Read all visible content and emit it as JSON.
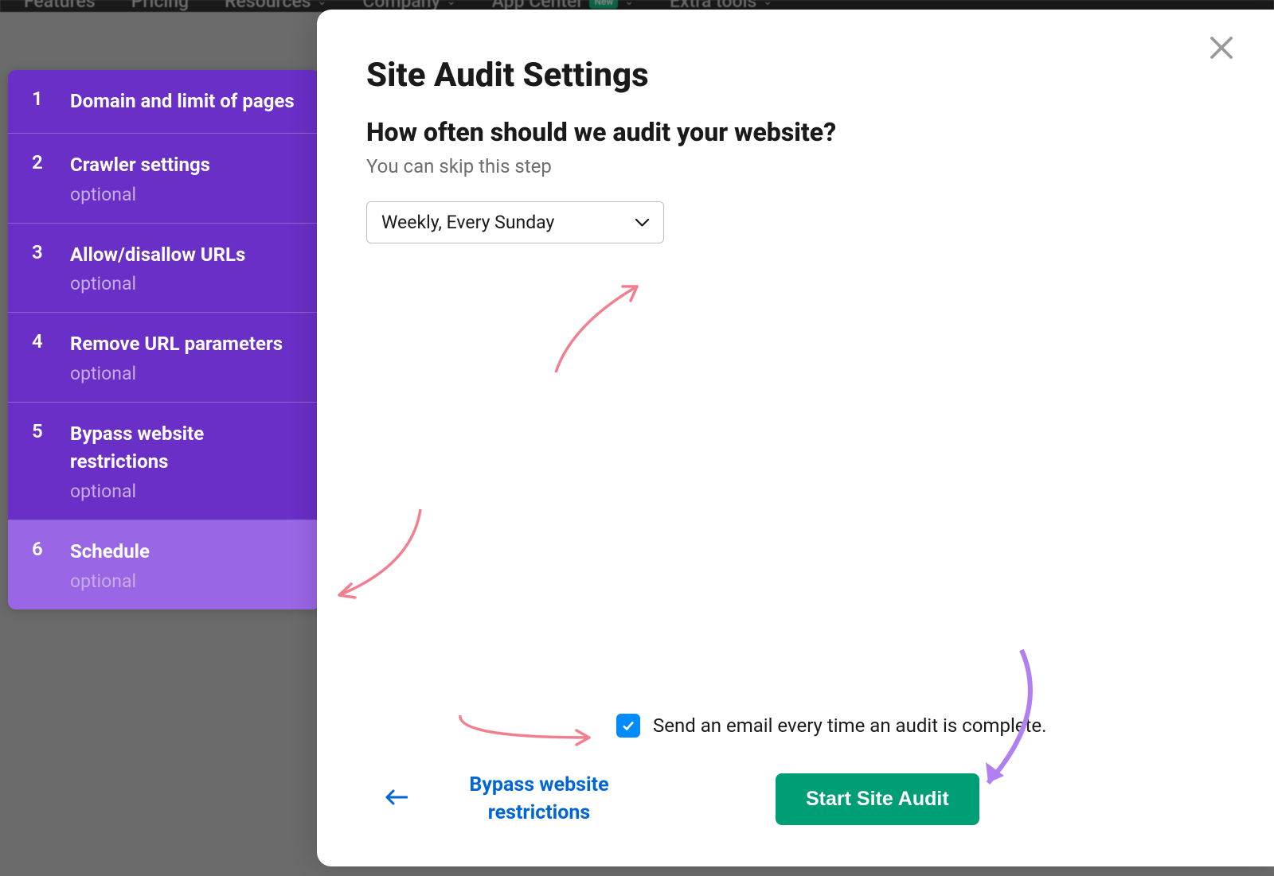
{
  "nav": {
    "items": [
      "Features",
      "Pricing",
      "Resources",
      "Company",
      "App Center",
      "Extra tools"
    ],
    "new_badge": "New"
  },
  "sidebar": {
    "steps": [
      {
        "number": "1",
        "title": "Domain and limit of pages",
        "optional": false
      },
      {
        "number": "2",
        "title": "Crawler settings",
        "optional": true
      },
      {
        "number": "3",
        "title": "Allow/disallow URLs",
        "optional": true
      },
      {
        "number": "4",
        "title": "Remove URL parameters",
        "optional": true
      },
      {
        "number": "5",
        "title": "Bypass website restrictions",
        "optional": true
      },
      {
        "number": "6",
        "title": "Schedule",
        "optional": true,
        "active": true
      }
    ],
    "optional_label": "optional"
  },
  "modal": {
    "title": "Site Audit Settings",
    "subtitle": "How often should we audit your website?",
    "hint": "You can skip this step",
    "select_value": "Weekly, Every Sunday",
    "checkbox_label": "Send an email every time an audit is complete.",
    "checkbox_checked": true,
    "back_link": "Bypass website restrictions",
    "start_button": "Start Site Audit"
  }
}
